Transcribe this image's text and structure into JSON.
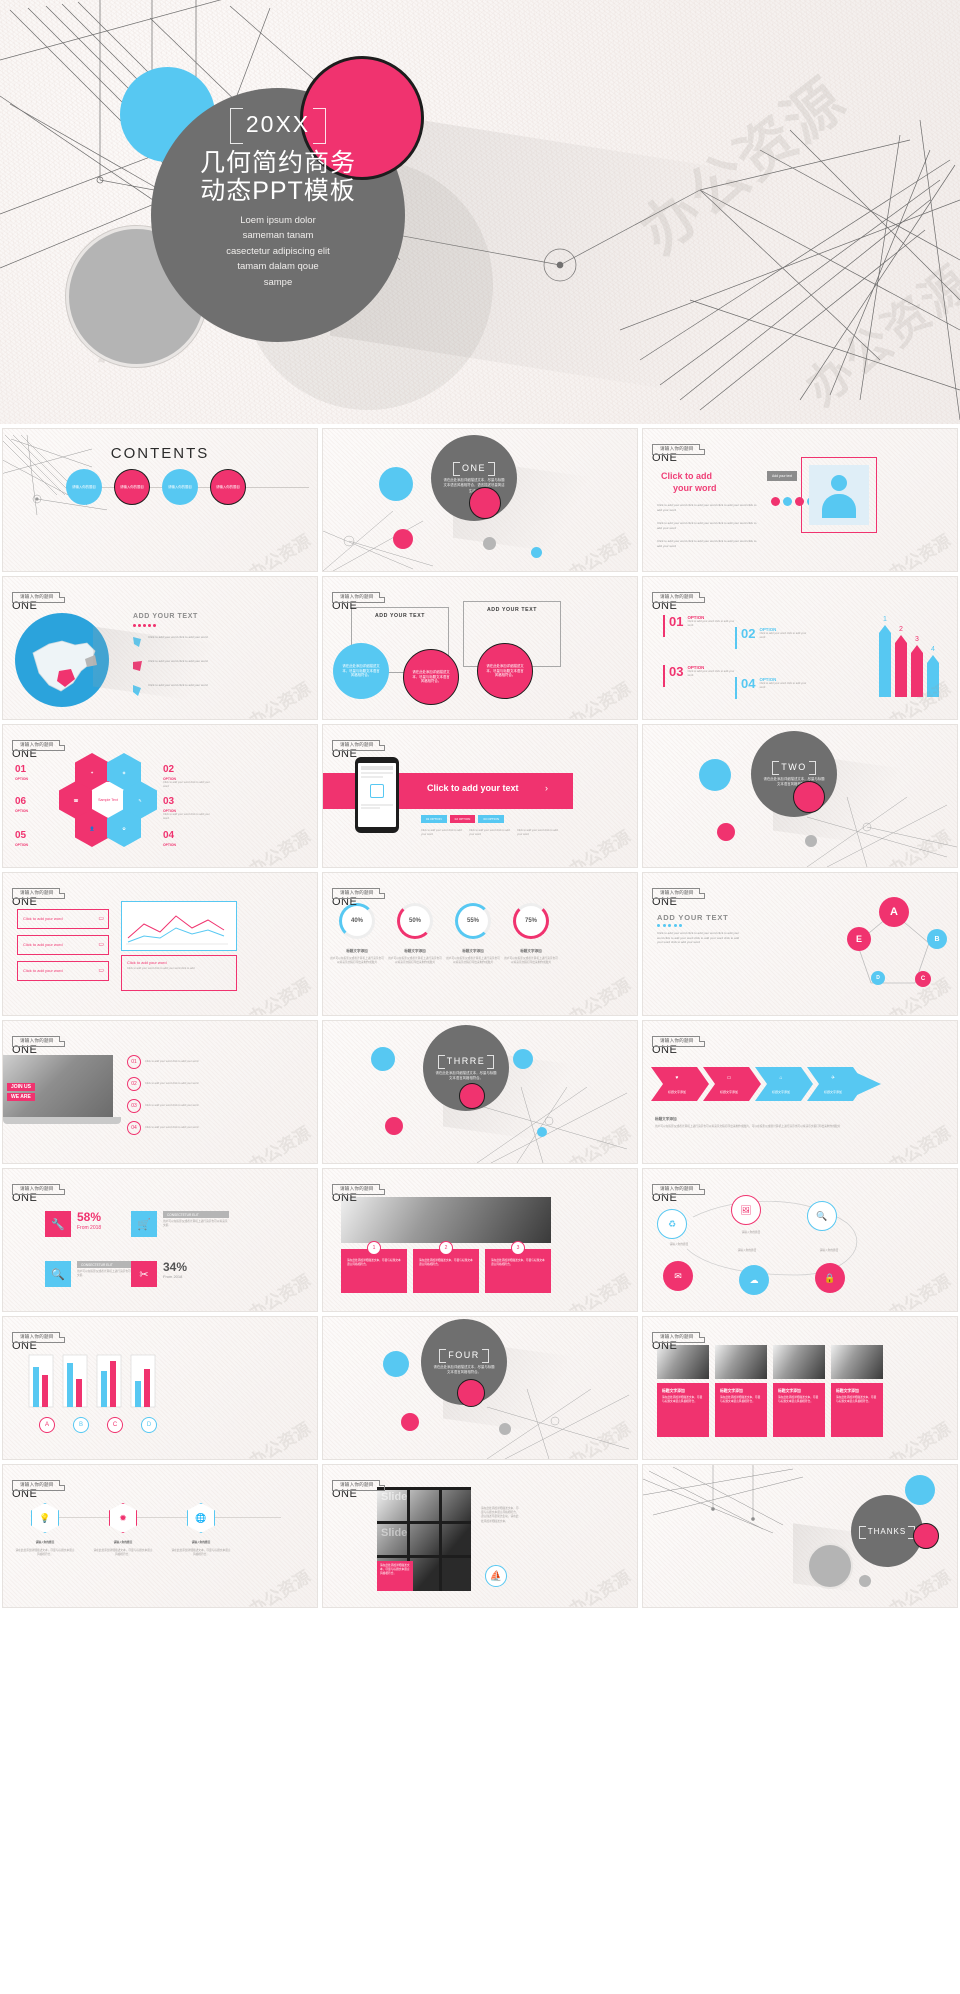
{
  "hero": {
    "year": "20XX",
    "title_line1": "几何简约商务",
    "title_line2": "动态PPT模板",
    "subtitle_line1": "Loem ipsum dolor",
    "subtitle_line2": "sameman tanam",
    "subtitle_line3": "casectetur adipiscing elit",
    "subtitle_line4": "tamam dalam qoue",
    "subtitle_line5": "sampe",
    "watermark": "办公资源"
  },
  "palette": {
    "pink": "#f0336f",
    "blue": "#57c8f2",
    "gray": "#6f6f6f",
    "light_gray": "#b6b6b6",
    "paper": "#f7f3f1"
  },
  "common": {
    "tag_cn": "请输入你的题目",
    "tag_one": "ONE",
    "cn_title": "标题文字添加",
    "cn_body": "用户可以在投影仪或者计算机上进行演示也可以将演示文稿打印出来制作成胶片",
    "cn_body_short": "请在此处添加详细描述文本，尽量与标题文本语言风格相符合，语言描述尽量简洁生动。",
    "lorem_short": "Click to add your word click to add your word",
    "lorem_long": "Click to add your word click to add your word click to add your word click to add your word click to add your word click to add your word",
    "option": "OPTION",
    "consectetur": "CONSECTETUR ELIT"
  },
  "slides": [
    {
      "n": 1,
      "name": "contents",
      "title": "CONTENTS",
      "nodes": [
        "请输入你的题目",
        "请输入你的题目",
        "请输入你的题目",
        "请输入你的题目"
      ]
    },
    {
      "n": 2,
      "name": "section-one",
      "badge": "ONE",
      "badge_text": "请在此处添加详细描述文本，尽量与标题文本语言风格相符合，语言描述尽量简洁生动。"
    },
    {
      "n": 3,
      "name": "click-to-add-your-word",
      "heading_l1": "Click to add",
      "heading_l2": "your word",
      "side_label": "Add your text",
      "paras": [
        "Click to add your word click to add your word click to add your word click to add your word",
        "Click to add your word click to add your word click to add your word click to add your word",
        "Click to add your word click to add your word click to add your word click to add your word"
      ]
    },
    {
      "n": 4,
      "name": "china-map",
      "heading": "ADD YOUR TEXT",
      "items": [
        "Click to add your word click to add your word",
        "Click to add your word click to add your word",
        "Click to add your word click to add your word"
      ]
    },
    {
      "n": 5,
      "name": "three-circles-add-your-text",
      "box_top": "ADD YOUR TEXT",
      "box_bottom": "ADD YOUR TEXT",
      "circles": [
        "请在此处添加详细描述文本，尽量与标题文本语言风格相符合。",
        "请在此处添加详细描述文本，尽量与标题文本语言风格相符合。",
        "请在此处添加详细描述文本，尽量与标题文本语言风格相符合。"
      ]
    },
    {
      "n": 6,
      "name": "option-arrows",
      "options": [
        {
          "num": "01",
          "label": "OPTION",
          "color": "#f0336f"
        },
        {
          "num": "02",
          "label": "OPTION",
          "color": "#57c8f2"
        },
        {
          "num": "03",
          "label": "OPTION",
          "color": "#f0336f"
        },
        {
          "num": "04",
          "label": "OPTION",
          "color": "#57c8f2"
        }
      ],
      "arrow_numbers": [
        "1",
        "2",
        "3",
        "4"
      ]
    },
    {
      "n": 7,
      "name": "hexagon-cluster",
      "center": "Sample Text",
      "options": [
        {
          "num": "01",
          "label": "OPTION"
        },
        {
          "num": "02",
          "label": "OPTION"
        },
        {
          "num": "03",
          "label": "OPTION"
        },
        {
          "num": "04",
          "label": "OPTION"
        },
        {
          "num": "05",
          "label": "OPTION"
        },
        {
          "num": "06",
          "label": "OPTION"
        }
      ]
    },
    {
      "n": 8,
      "name": "phone-mockup",
      "banner": "Click to add your text",
      "tabs": [
        "01 OPTION",
        "02 OPTION",
        "03 OPTION"
      ],
      "paras": [
        "Click to add your word click to add your word",
        "Click to add your word click to add your word",
        "Click to add your word click to add your word"
      ]
    },
    {
      "n": 9,
      "name": "section-two",
      "badge": "TWO",
      "badge_text": "请在此处添加详细描述文本，尽量与标题文本语言风格相符合。"
    },
    {
      "n": 10,
      "name": "chart-and-cards",
      "cards": [
        "Click to add your word",
        "Click to add your word",
        "Click to add your word"
      ],
      "chart_caption": "Click to add your word",
      "chart_body": "Click to add your word click to add your word click to add"
    },
    {
      "n": 11,
      "name": "percent-rings",
      "rings": [
        {
          "value": "40%",
          "color": "#57c8f2",
          "title": "标题文字添加"
        },
        {
          "value": "50%",
          "color": "#f0336f",
          "title": "标题文字添加"
        },
        {
          "value": "55%",
          "color": "#57c8f2",
          "title": "标题文字添加"
        },
        {
          "value": "75%",
          "color": "#f0336f",
          "title": "标题文字添加"
        }
      ],
      "body": "用户可以在投影仪或者计算机上进行演示也可以将演示文稿打印出来制作成胶片"
    },
    {
      "n": 12,
      "name": "pentagon-nodes",
      "heading": "ADD YOUR TEXT",
      "body": "Click to add your word click to add your word click to add your word click to add your word click to add your word click to add your word click to add your word",
      "nodes": [
        "A",
        "B",
        "C",
        "D",
        "E"
      ]
    },
    {
      "n": 13,
      "name": "laptop-list",
      "items": [
        {
          "num": "01",
          "text": "Click to add your word click to add your word"
        },
        {
          "num": "02",
          "text": "Click to add your word click to add your word"
        },
        {
          "num": "03",
          "text": "Click to add your word click to add your word"
        },
        {
          "num": "04",
          "text": "Click to add your word click to add your word"
        }
      ],
      "photo_label_l1": "JOIN US",
      "photo_label_l2": "WE ARE"
    },
    {
      "n": 14,
      "name": "section-three",
      "badge": "THRRE",
      "badge_text": "请在此处添加详细描述文本，尽量与标题文本语言风格相符合。"
    },
    {
      "n": 15,
      "name": "arrow-chevrons",
      "steps": [
        "标题文字添加",
        "标题文字添加",
        "标题文字添加",
        "标题文字添加"
      ],
      "caption": "标题文字添加",
      "body": "用户可以在投影仪或者计算机上进行演示也可以将演示文稿打印出来制作成胶片，可以在投影仪或者计算机上进行演示也可以将演示文稿打印出来制作成胶片"
    },
    {
      "n": 16,
      "name": "stats-icons",
      "stats": [
        {
          "value": "58%",
          "sub": "From 2018",
          "color": "#f0336f",
          "icon": "wrench-icon"
        },
        {
          "title": "CONSECTETUR ELIT",
          "color": "#57c8f2",
          "icon": "cart-icon",
          "body": "用户可以在投影仪或者计算机上进行演示也可以将演示文稿"
        },
        {
          "title": "CONSECTETUR ELIT",
          "color": "#57c8f2",
          "icon": "search-doc-icon",
          "body": "用户可以在投影仪或者计算机上进行演示也可以将演示文稿"
        },
        {
          "value": "34%",
          "sub": "From 2018",
          "color": "#f0336f",
          "icon": "scissors-icon"
        }
      ]
    },
    {
      "n": 17,
      "name": "photo-three-cards",
      "numbers": [
        "1",
        "2",
        "3"
      ],
      "cards": [
        "请在此处添加详细描述文本，尽量与标题文本语言风格相符合。",
        "请在此处添加详细描述文本，尽量与标题文本语言风格相符合。",
        "请在此处添加详细描述文本，尽量与标题文本语言风格相符合。"
      ]
    },
    {
      "n": 18,
      "name": "circle-network",
      "labels": [
        "请输入你的题目",
        "请输入你的题目",
        "请输入你的题目",
        "请输入你的题目"
      ]
    },
    {
      "n": 19,
      "name": "bar-columns",
      "columns": [
        "A",
        "B",
        "C",
        "D"
      ]
    },
    {
      "n": 20,
      "name": "section-four",
      "badge": "FOUR",
      "badge_text": "请在此处添加详细描述文本，尽量与标题文本语言风格相符合。"
    },
    {
      "n": 21,
      "name": "four-photo-cards",
      "cards": [
        {
          "title": "标题文字添加",
          "body": "请在此处添加详细描述文本，尽量与标题文本语言风格相符合。"
        },
        {
          "title": "标题文字添加",
          "body": "请在此处添加详细描述文本，尽量与标题文本语言风格相符合。"
        },
        {
          "title": "标题文字添加",
          "body": "请在此处添加详细描述文本，尽量与标题文本语言风格相符合。"
        },
        {
          "title": "标题文字添加",
          "body": "请在此处添加详细描述文本，尽量与标题文本语言风格相符合。"
        }
      ]
    },
    {
      "n": 22,
      "name": "three-hex-icons",
      "items": [
        {
          "title": "请输入你的题目",
          "icon": "bulb-icon"
        },
        {
          "title": "请输入你的题目",
          "icon": "star-icon"
        },
        {
          "title": "请输入你的题目",
          "icon": "globe-icon"
        }
      ],
      "body": "请在此处添加详细描述文本，尽量与标题文本语言风格相符合。"
    },
    {
      "n": 23,
      "name": "slide-photo-grid",
      "photo_text": "Slide",
      "body": "请在此处添加详细描述文本，尽量与标题文本语言风格相符合，语言描述尽量简洁生动。请在此处添加详细描述文本。",
      "pink_note": "请在此处添加详细描述文本，尽量与标题文本语言风格相符合。",
      "icon": "sailboat-icon"
    },
    {
      "n": 24,
      "name": "thanks",
      "badge": "THANKS"
    }
  ]
}
